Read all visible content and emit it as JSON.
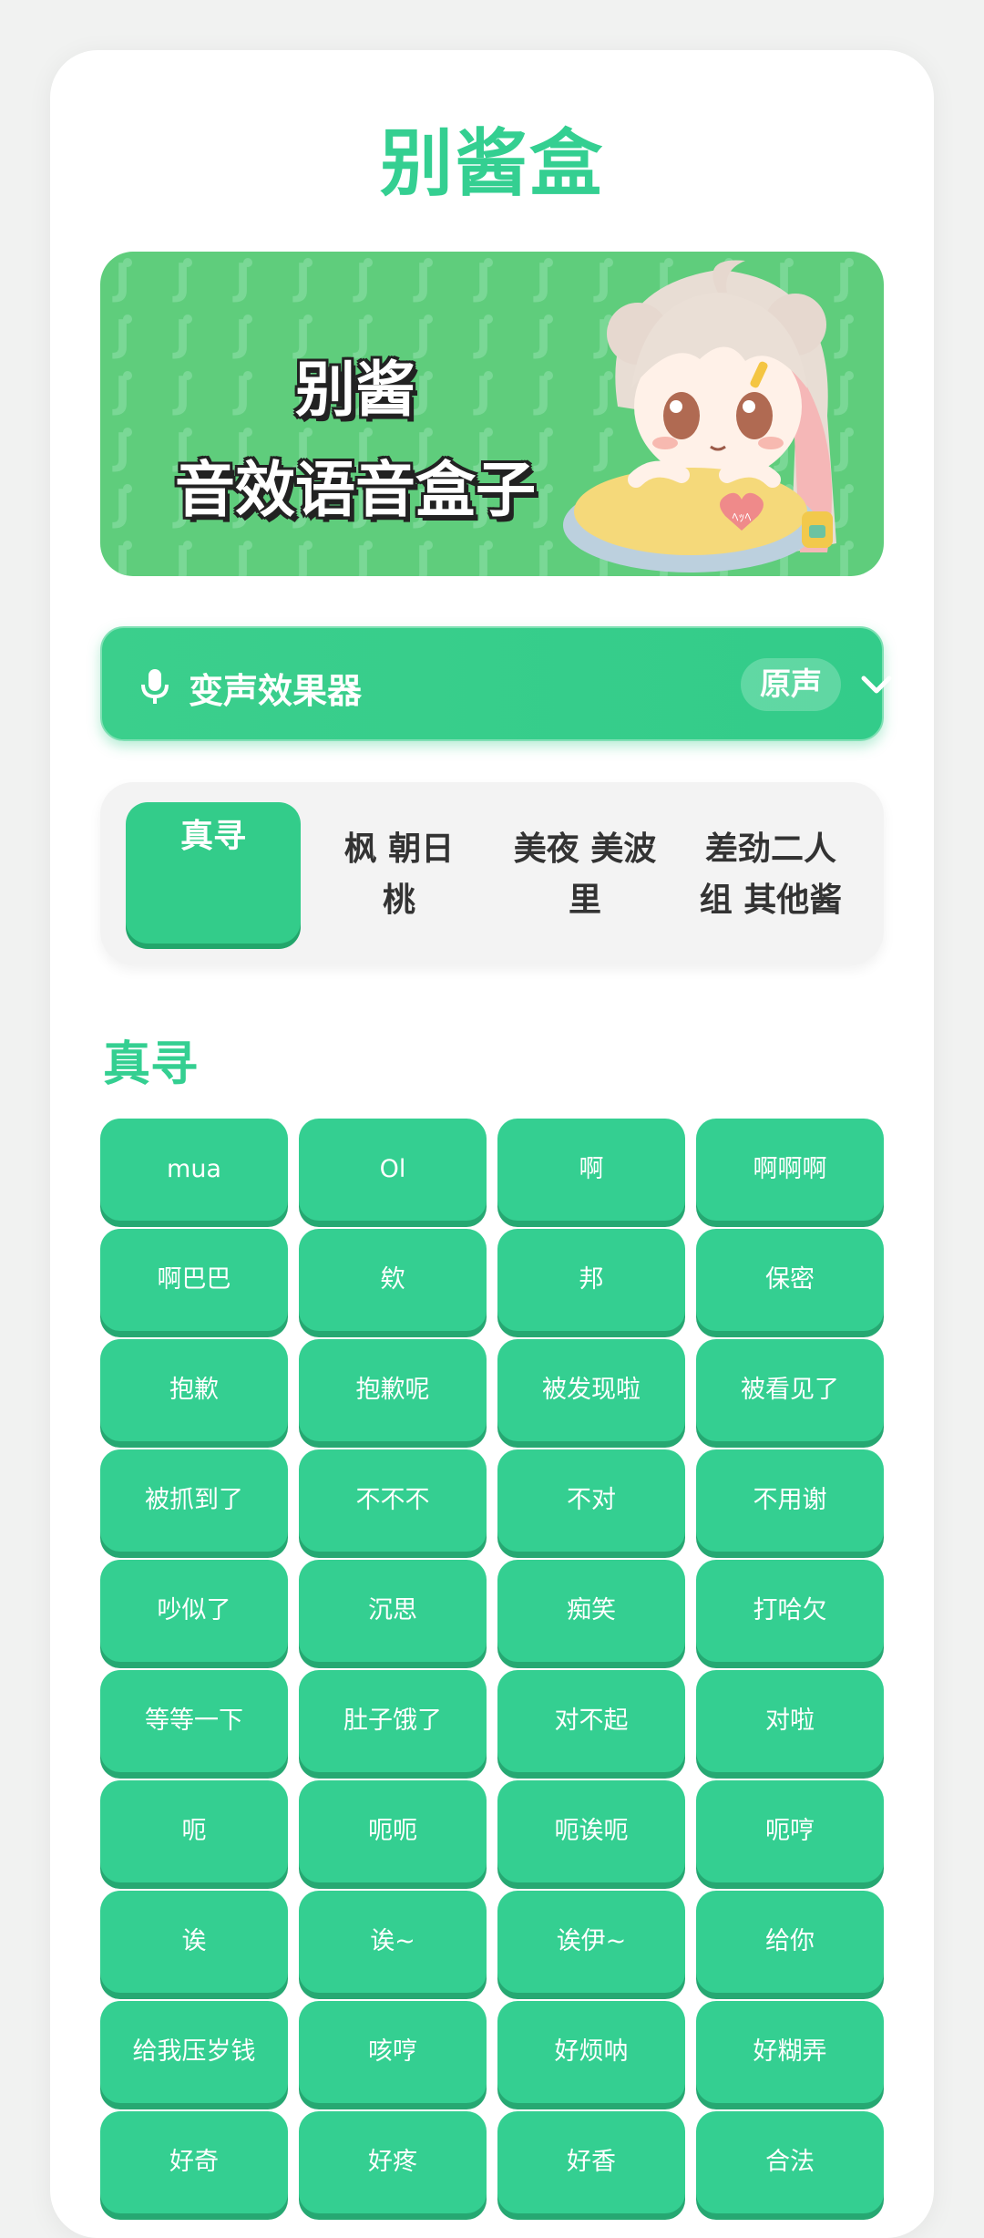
{
  "app": {
    "title": "别酱盒"
  },
  "banner": {
    "line1": "别酱",
    "line2": "音效语音盒子",
    "mascot_badge": "ﾍｯﾍ"
  },
  "voice_changer": {
    "label": "变声效果器",
    "value": "原声",
    "icon": "mic-icon",
    "dropdown_icon": "chevron-down-icon"
  },
  "tabs": [
    {
      "label": "真寻",
      "active": true
    },
    {
      "label": "枫 朝日\n桃"
    },
    {
      "label": "美夜 美波\n里"
    },
    {
      "label": "差劲二人\n组 其他酱"
    }
  ],
  "section": {
    "title": "真寻"
  },
  "buttons": [
    "mua",
    "Ol",
    "啊",
    "啊啊啊",
    "啊巴巴",
    "欸",
    "邦",
    "保密",
    "抱歉",
    "抱歉呢",
    "被发现啦",
    "被看见了",
    "被抓到了",
    "不不不",
    "不对",
    "不用谢",
    "吵似了",
    "沉思",
    "痴笑",
    "打哈欠",
    "等等一下",
    "肚子饿了",
    "对不起",
    "对啦",
    "呃",
    "呃呃",
    "呃诶呃",
    "呃哼",
    "诶",
    "诶~",
    "诶伊~",
    "给你",
    "给我压岁钱",
    "咳哼",
    "好烦呐",
    "好糊弄",
    "好奇",
    "好疼",
    "好香",
    "合法"
  ],
  "colors": {
    "accent": "#34cf91",
    "accent_dark": "#26a872",
    "banner_bg": "#5fcd7c"
  }
}
